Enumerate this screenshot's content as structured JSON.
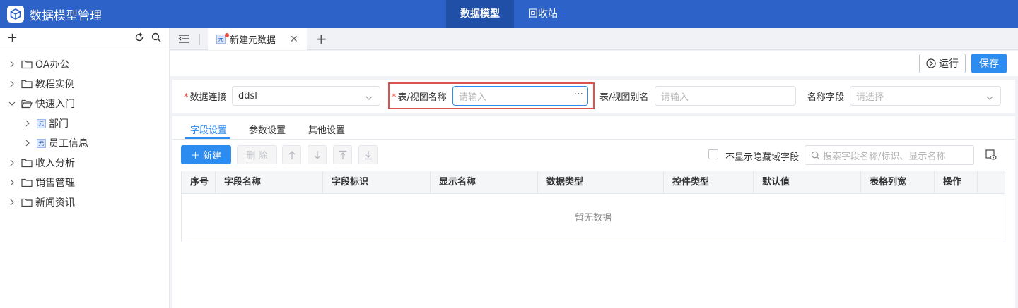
{
  "app": {
    "title": "数据模型管理"
  },
  "topnav": {
    "items": [
      {
        "label": "数据模型"
      },
      {
        "label": "回收站"
      }
    ]
  },
  "sidebar": {
    "tree": [
      {
        "label": "OA办公"
      },
      {
        "label": "教程实例"
      },
      {
        "label": "快速入门"
      },
      {
        "label": "部门"
      },
      {
        "label": "员工信息"
      },
      {
        "label": "收入分析"
      },
      {
        "label": "销售管理"
      },
      {
        "label": "新闻资讯"
      }
    ],
    "yuan_tag": "元"
  },
  "tabs": {
    "items": [
      {
        "label": "新建元数据"
      }
    ]
  },
  "actions": {
    "run_label": "运行",
    "save_label": "保存"
  },
  "form": {
    "connection": {
      "label": "数据连接",
      "value": "ddsl"
    },
    "table_name": {
      "label": "表/视图名称",
      "placeholder": "请输入"
    },
    "alias": {
      "label": "表/视图别名",
      "placeholder": "请输入"
    },
    "name_field": {
      "label": "名称字段",
      "placeholder": "请选择"
    }
  },
  "subtabs": {
    "items": [
      {
        "label": "字段设置"
      },
      {
        "label": "参数设置"
      },
      {
        "label": "其他设置"
      }
    ]
  },
  "toolbar": {
    "new_label": "＋ 新建",
    "delete_label": "删 除",
    "hide_fields_label": "不显示隐藏域字段",
    "search_placeholder": "搜索字段名称/标识、显示名称"
  },
  "table": {
    "columns": [
      "序号",
      "字段名称",
      "字段标识",
      "显示名称",
      "数据类型",
      "控件类型",
      "默认值",
      "表格列宽",
      "操作"
    ],
    "empty_text": "暂无数据"
  },
  "colors": {
    "topbar": "#2d63c8",
    "primary": "#2d8cf0",
    "highlight": "#d9534f"
  }
}
